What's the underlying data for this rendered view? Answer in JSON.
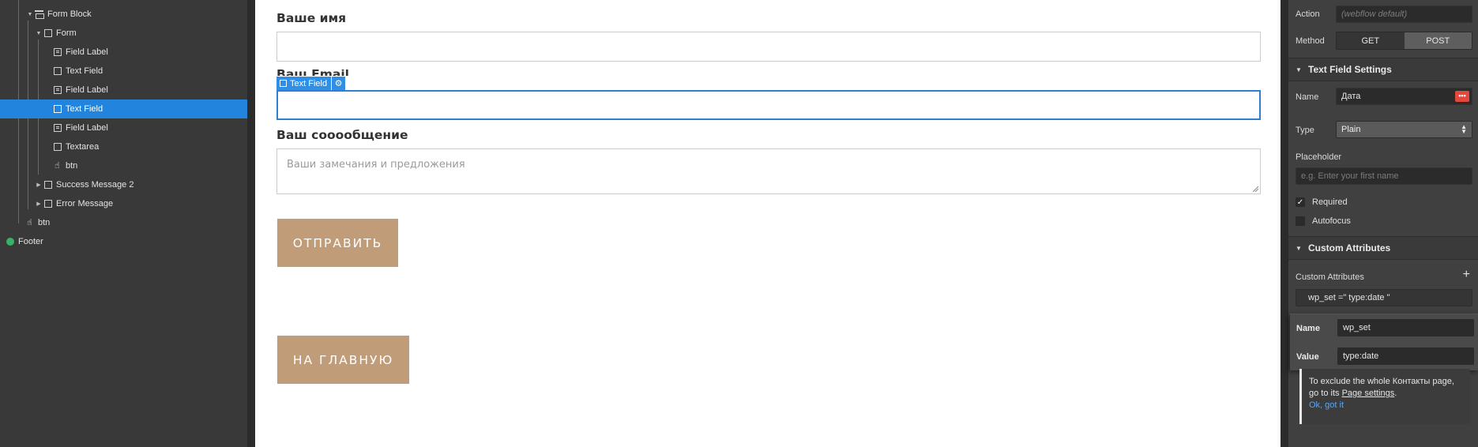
{
  "navigator": {
    "items": [
      {
        "label": "Form Block",
        "icon": "form-block-icon",
        "expanded": true
      },
      {
        "label": "Form",
        "icon": "box-icon",
        "expanded": true
      },
      {
        "label": "Field Label",
        "icon": "label-icon"
      },
      {
        "label": "Text Field",
        "icon": "box-icon"
      },
      {
        "label": "Field Label",
        "icon": "label-icon"
      },
      {
        "label": "Text Field",
        "icon": "box-icon",
        "selected": true
      },
      {
        "label": "Field Label",
        "icon": "label-icon"
      },
      {
        "label": "Textarea",
        "icon": "box-icon"
      },
      {
        "label": "btn",
        "icon": "hand-pointer-icon"
      },
      {
        "label": "Success Message 2",
        "icon": "box-icon",
        "expanded": false
      },
      {
        "label": "Error Message",
        "icon": "box-icon",
        "expanded": false
      },
      {
        "label": "btn",
        "icon": "hand-pointer-icon"
      },
      {
        "label": "Footer",
        "icon": "component-icon"
      }
    ],
    "selected_color": "#2384dd"
  },
  "canvas": {
    "name_label": "Ваше имя",
    "email_label": "Ваш Email",
    "message_label": "Ваш сооообщение",
    "message_placeholder": "Ваши замечания и предложения",
    "selection_tag": "Text Field",
    "submit_button": "ОТПРАВИТЬ",
    "home_button": "НА ГЛАВНУЮ",
    "button_color": "#c09c78",
    "selection_color": "#2d8fe8"
  },
  "panel": {
    "action_label": "Action",
    "action_placeholder": "(webflow default)",
    "method_label": "Method",
    "method_get": "GET",
    "method_post": "POST",
    "text_field_settings_title": "Text Field Settings",
    "name_label": "Name",
    "name_value": "Дата",
    "type_label": "Type",
    "type_value": "Plain",
    "placeholder_label": "Placeholder",
    "placeholder_hint": "e.g. Enter your first name",
    "required_label": "Required",
    "required_checked": true,
    "autofocus_label": "Autofocus",
    "autofocus_checked": false,
    "custom_attributes_title": "Custom Attributes",
    "custom_attributes_label": "Custom Attributes",
    "attribute_summary": "wp_set =\" type:date \"",
    "popup_name_label": "Name",
    "popup_name_value": "wp_set",
    "popup_value_label": "Value",
    "popup_value_value": "type:date",
    "notice_line1": "To exclude the whole Контакты page,",
    "notice_line2_prefix": "go to its ",
    "notice_link": "Page settings",
    "notice_line2_suffix": ".",
    "notice_ok": "Ok, got it",
    "more_button_color": "#e2493c"
  }
}
